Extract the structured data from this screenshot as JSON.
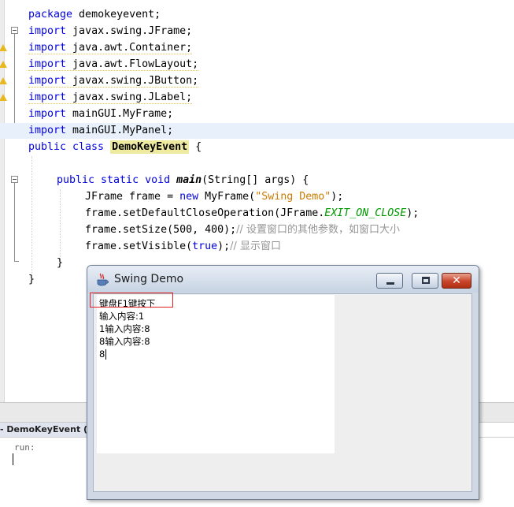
{
  "editor": {
    "lines": {
      "l0": {
        "package_kw": "package",
        "package_name": " demokeyevent;"
      },
      "imports": [
        {
          "kw": "import",
          "path": " javax.swing.JFrame;"
        },
        {
          "kw": "import",
          "path": " java.awt.Container;"
        },
        {
          "kw": "import",
          "path": " java.awt.FlowLayout;"
        },
        {
          "kw": "import",
          "path": " javax.swing.JButton;"
        },
        {
          "kw": "import",
          "path": " javax.swing.JLabel;"
        },
        {
          "kw": "import",
          "path": " mainGUI.MyFrame;"
        },
        {
          "kw": "import",
          "path": " mainGUI.MyPanel;"
        }
      ],
      "class_decl": {
        "kw": "public class",
        "name": "DemoKeyEvent",
        "brace": " {"
      },
      "main_decl": {
        "kw": "public static void",
        "name": "main",
        "params": "(String[] args) {"
      },
      "frame_decl": {
        "type": "JFrame frame = ",
        "new_kw": "new",
        "ctor": " MyFrame(",
        "str": "\"Swing Demo\"",
        "end": ");"
      },
      "close_op": {
        "call": "frame.setDefaultCloseOperation(JFrame.",
        "const": "EXIT_ON_CLOSE",
        "end": ");"
      },
      "set_size": {
        "call": "frame.setSize(500, 400);",
        "comment": "// 设置窗口的其他参数，如窗口大小"
      },
      "set_visible": {
        "call": "frame.setVisible(",
        "true_kw": "true",
        "end": ");",
        "comment": "// 显示窗口"
      },
      "close_brace_inner": "}",
      "close_brace_outer": "}"
    }
  },
  "output": {
    "tab_label": "- DemoKeyEvent (ru",
    "text": "run:"
  },
  "swing_window": {
    "title": "Swing Demo",
    "close_label": "✕",
    "text_lines": [
      "键盘F1键按下",
      "输入内容:1",
      "1输入内容:8",
      "8输入内容:8",
      "8"
    ]
  },
  "colors": {
    "keyword": "#0000e6",
    "string": "#ce7b00",
    "comment": "#969696",
    "constant": "#009900",
    "highlight": "#red"
  }
}
